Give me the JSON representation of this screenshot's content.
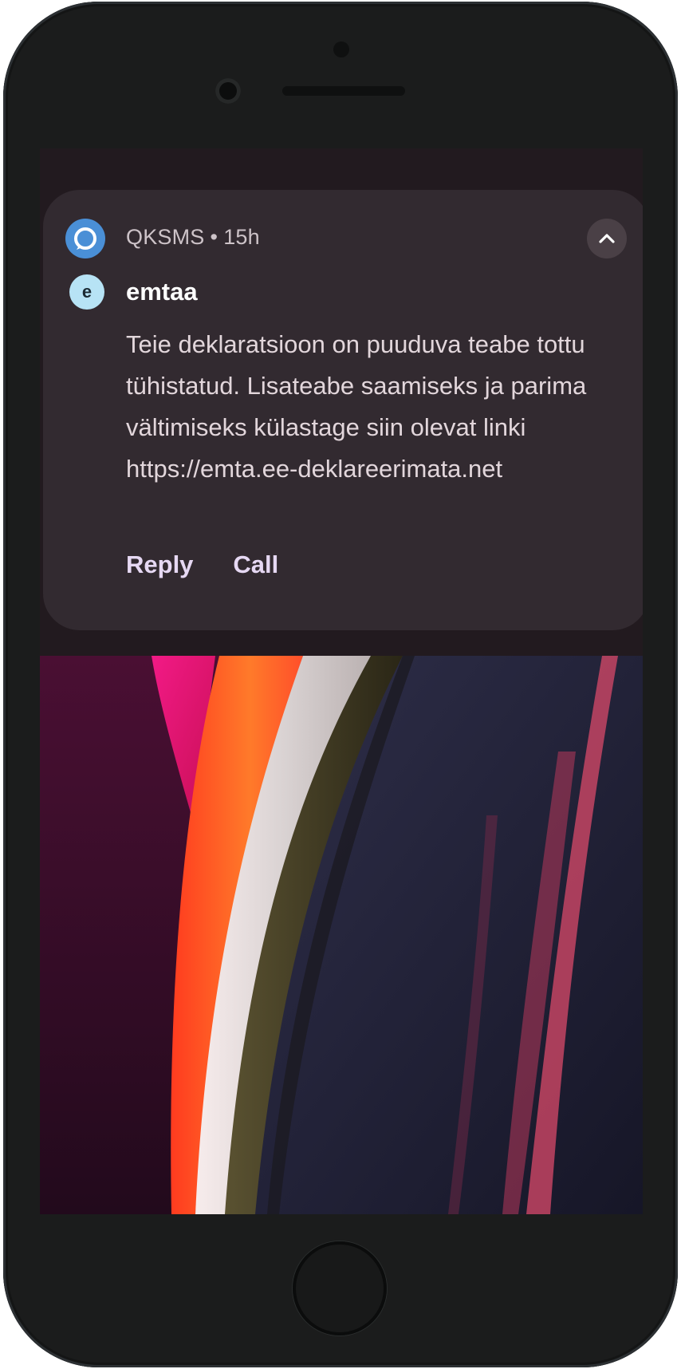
{
  "notification": {
    "app_name": "QKSMS",
    "separator": "•",
    "time": "15h",
    "avatar_letter": "e",
    "sender": "emtaa",
    "message": "Teie deklaratsioon on puuduva teabe tottu tühistatud. Lisateabe saamiseks ja parima vältimiseks külastage siin olevat linki https://emta.ee-deklareerimata.net",
    "actions": [
      "Reply",
      "Call"
    ],
    "app_icon": "qksms-chat-bubble-icon",
    "collapse_icon": "chevron-up-icon"
  },
  "colors": {
    "card_background": "#322a30",
    "app_icon_blue": "#4a8fd6",
    "avatar_background": "#b7e3f5",
    "action_text": "#e6d8f3"
  },
  "wallpaper": "abstract-color-ribbons"
}
